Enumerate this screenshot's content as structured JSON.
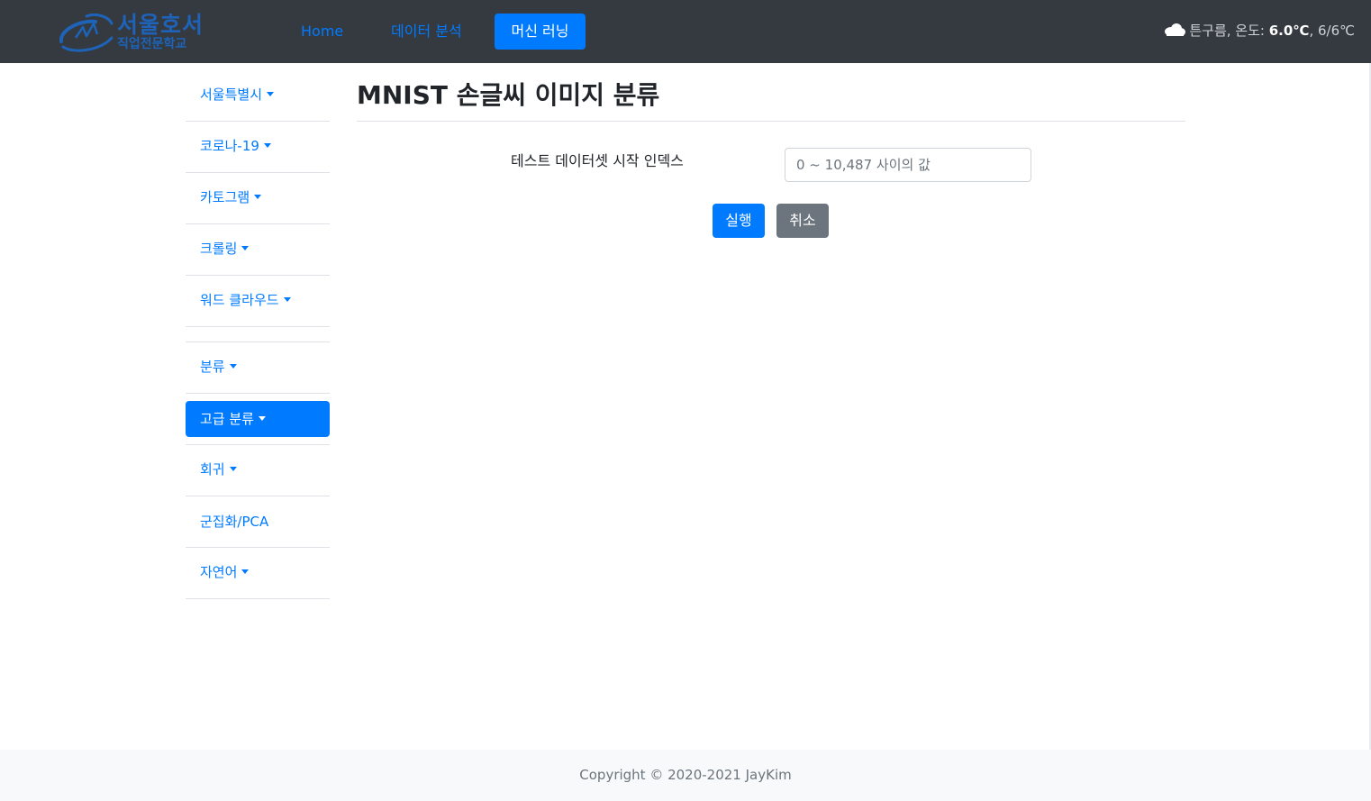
{
  "brand": {
    "line1": "서울호서",
    "line2": "직업전문학교",
    "color": "#1e63b8"
  },
  "nav": {
    "items": [
      {
        "label": "Home"
      },
      {
        "label": "데이터 분석"
      },
      {
        "label": "머신 러닝",
        "active": true
      }
    ]
  },
  "weather": {
    "icon": "cloud-icon",
    "condition": "튼구름, 온도: ",
    "temp": "6.0℃",
    "range": ", 6/6℃"
  },
  "sidebar": {
    "items": [
      {
        "label": "서울특별시",
        "dropdown": true
      },
      {
        "label": "코로나-19",
        "dropdown": true
      },
      {
        "label": "카토그램",
        "dropdown": true
      },
      {
        "label": "크롤링",
        "dropdown": true
      },
      {
        "label": "워드 클라우드",
        "dropdown": true
      },
      {
        "label": "분류",
        "dropdown": true
      },
      {
        "label": "고급 분류",
        "dropdown": true,
        "active": true
      },
      {
        "label": "회귀",
        "dropdown": true
      },
      {
        "label": "군집화/PCA",
        "dropdown": false
      },
      {
        "label": "자연어",
        "dropdown": true
      }
    ]
  },
  "main": {
    "title": "MNIST 손글씨 이미지 분류",
    "form": {
      "label": "테스트 데이터셋 시작 인덱스",
      "value": "",
      "placeholder": "0 ~ 10,487 사이의 값"
    },
    "run_label": "실행",
    "cancel_label": "취소"
  },
  "footer": {
    "text": "Copyright © 2020-2021 JayKim"
  },
  "colors": {
    "navbar": "#343a40",
    "primary": "#007bff",
    "secondary": "#6c757d",
    "footer_bg": "#f8f9fa"
  }
}
